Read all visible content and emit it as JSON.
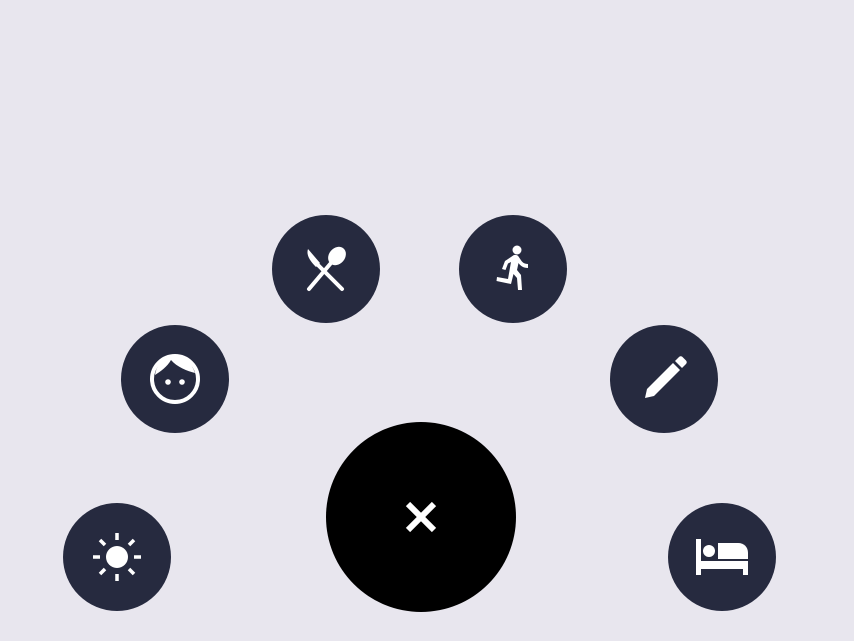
{
  "menu": {
    "items": [
      {
        "icon": "sun-icon"
      },
      {
        "icon": "face-icon"
      },
      {
        "icon": "dining-icon"
      },
      {
        "icon": "directions-run-icon"
      },
      {
        "icon": "pencil-edit-icon"
      },
      {
        "icon": "bed-icon"
      }
    ],
    "main_button": {
      "icon": "close-icon"
    }
  },
  "colors": {
    "background": "#e8e6ee",
    "item_fill": "#262a3f",
    "main_fill": "#000000",
    "icon": "#ffffff"
  }
}
